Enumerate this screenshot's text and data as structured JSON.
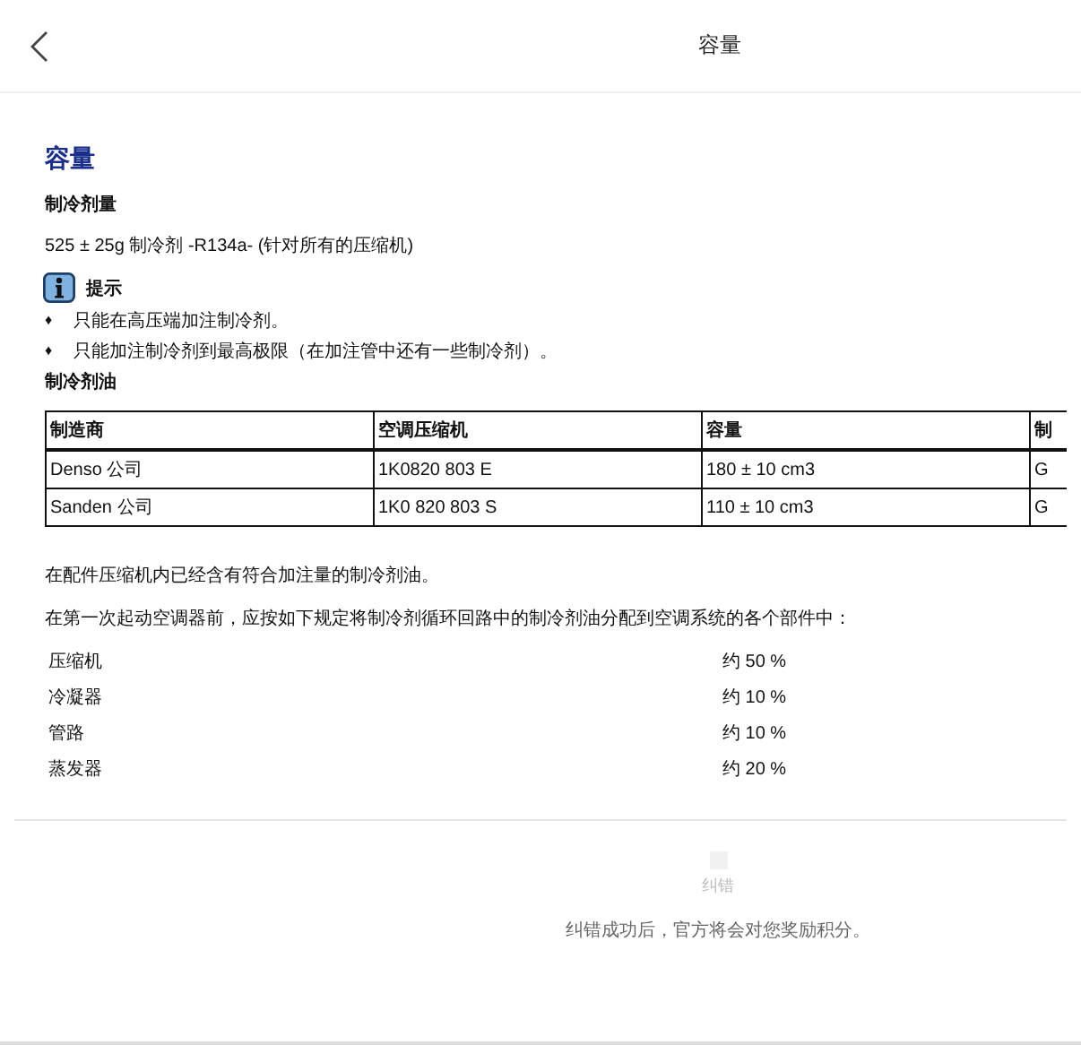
{
  "header": {
    "title": "容量"
  },
  "content": {
    "heading": "容量",
    "refrigerant_heading": "制冷剂量",
    "refrigerant_text": "525 ± 25g 制冷剂 -R134a- (针对所有的压缩机)",
    "note": {
      "label": "提示",
      "bullets": [
        {
          "marker": "♦",
          "text": "只能在高压端加注制冷剂。"
        },
        {
          "marker": "♦",
          "text": "只能加注制冷剂到最高极限（在加注管中还有一些制冷剂）。"
        }
      ]
    },
    "oil_heading": "制冷剂油",
    "table": {
      "columns": [
        "制造商",
        "空调压缩机",
        "容量",
        "制"
      ],
      "rows": [
        [
          "Denso 公司",
          "1K0820 803 E",
          "180 ± 10 cm3",
          "G"
        ],
        [
          "Sanden 公司",
          "1K0 820 803 S",
          "110 ± 10 cm3",
          "G"
        ]
      ]
    },
    "paragraphs": [
      "在配件压缩机内已经含有符合加注量的制冷剂油。",
      "在第一次起动空调器前，应按如下规定将制冷剂循环回路中的制冷剂油分配到空调系统的各个部件中："
    ],
    "distribution": [
      {
        "part": "压缩机",
        "share": "约 50 %"
      },
      {
        "part": "冷凝器",
        "share": "约 10 %"
      },
      {
        "part": "管路",
        "share": "约 10 %"
      },
      {
        "part": "蒸发器",
        "share": "约 20 %"
      }
    ]
  },
  "footer": {
    "correction_label": "纠错",
    "message": "纠错成功后，官方将会对您奖励积分。"
  }
}
